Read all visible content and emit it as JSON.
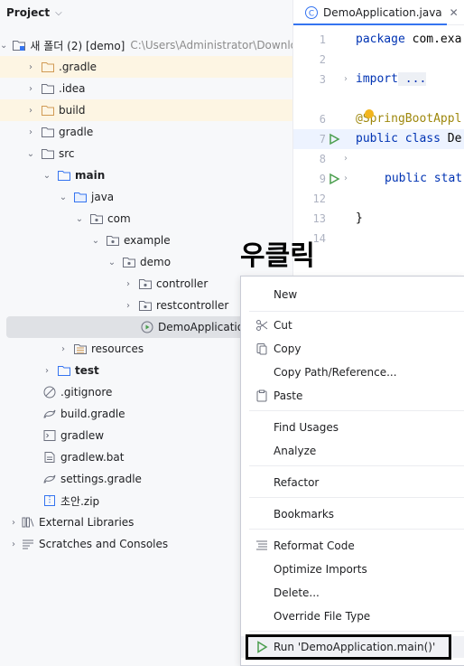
{
  "project_panel": {
    "title": "Project",
    "root": {
      "label": "새 폴더 (2) [demo]",
      "path": "C:\\Users\\Administrator\\Downloads"
    },
    "items": [
      {
        "label": ".gradle"
      },
      {
        "label": ".idea"
      },
      {
        "label": "build"
      },
      {
        "label": "gradle"
      },
      {
        "label": "src"
      },
      {
        "label": "main"
      },
      {
        "label": "java"
      },
      {
        "label": "com"
      },
      {
        "label": "example"
      },
      {
        "label": "demo"
      },
      {
        "label": "controller"
      },
      {
        "label": "restcontroller"
      },
      {
        "label": "DemoApplication"
      },
      {
        "label": "resources"
      },
      {
        "label": "test"
      },
      {
        "label": ".gitignore"
      },
      {
        "label": "build.gradle"
      },
      {
        "label": "gradlew"
      },
      {
        "label": "gradlew.bat"
      },
      {
        "label": "settings.gradle"
      },
      {
        "label": "초안.zip"
      },
      {
        "label": "External Libraries"
      },
      {
        "label": "Scratches and Consoles"
      }
    ]
  },
  "editor": {
    "tab_label": "DemoApplication.java",
    "line_numbers": [
      "1",
      "2",
      "3",
      "6",
      "7",
      "8",
      "9",
      "12",
      "13",
      "14"
    ],
    "code": {
      "l1_kw": "package",
      "l1_rest": " com.exa",
      "l3_kw": "import",
      "l3_rest": " ...",
      "l6": "@SpringBootAppl",
      "l7_kw": "public class",
      "l7_rest": " De",
      "l9_kw": "public stat",
      "l13": "}"
    }
  },
  "annotation": "우클릭",
  "context_menu": {
    "items": [
      {
        "label": "New"
      },
      {
        "label": "Cut"
      },
      {
        "label": "Copy"
      },
      {
        "label": "Copy Path/Reference..."
      },
      {
        "label": "Paste"
      },
      {
        "label": "Find Usages"
      },
      {
        "label": "Analyze"
      },
      {
        "label": "Refactor"
      },
      {
        "label": "Bookmarks"
      },
      {
        "label": "Reformat Code"
      },
      {
        "label": "Optimize Imports"
      },
      {
        "label": "Delete..."
      },
      {
        "label": "Override File Type"
      },
      {
        "label": "Run 'DemoApplication.main()'"
      }
    ]
  },
  "colors": {
    "accent": "#3574f0",
    "folder_excluded_bg": "#fdf5e3",
    "run_green": "#4a9e4e",
    "highlight_box": "#000000"
  }
}
